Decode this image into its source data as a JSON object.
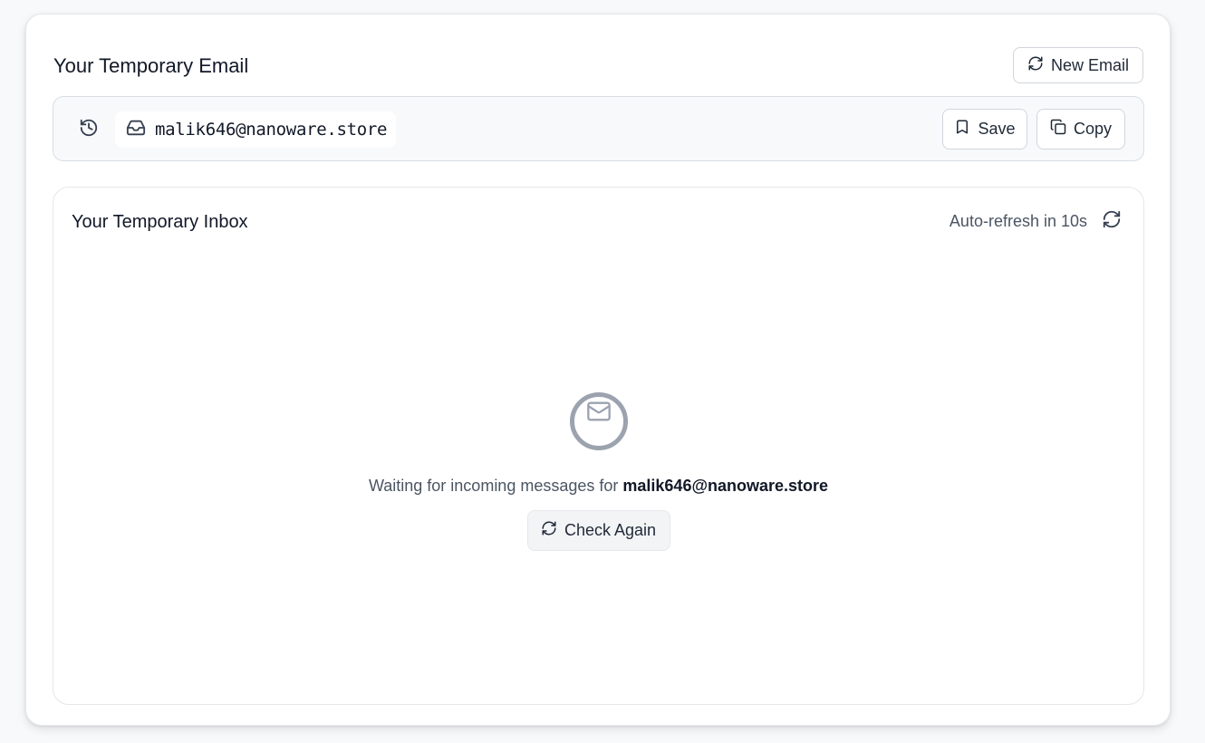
{
  "header": {
    "title": "Your Temporary Email",
    "new_email_label": "New Email"
  },
  "address": {
    "email": "malik646@nanoware.store",
    "save_label": "Save",
    "copy_label": "Copy"
  },
  "inbox": {
    "title": "Your Temporary Inbox",
    "auto_refresh_text": "Auto-refresh in 10s",
    "waiting_prefix": "Waiting for incoming messages for ",
    "waiting_email": "malik646@nanoware.store",
    "check_again_label": "Check Again"
  },
  "icons": {
    "new_email": "refresh-icon",
    "history": "history-icon",
    "inbox": "inbox-icon",
    "save": "bookmark-icon",
    "copy": "copy-icon",
    "auto_refresh": "refresh-icon",
    "empty": "mail-icon",
    "check_again": "refresh-icon"
  }
}
